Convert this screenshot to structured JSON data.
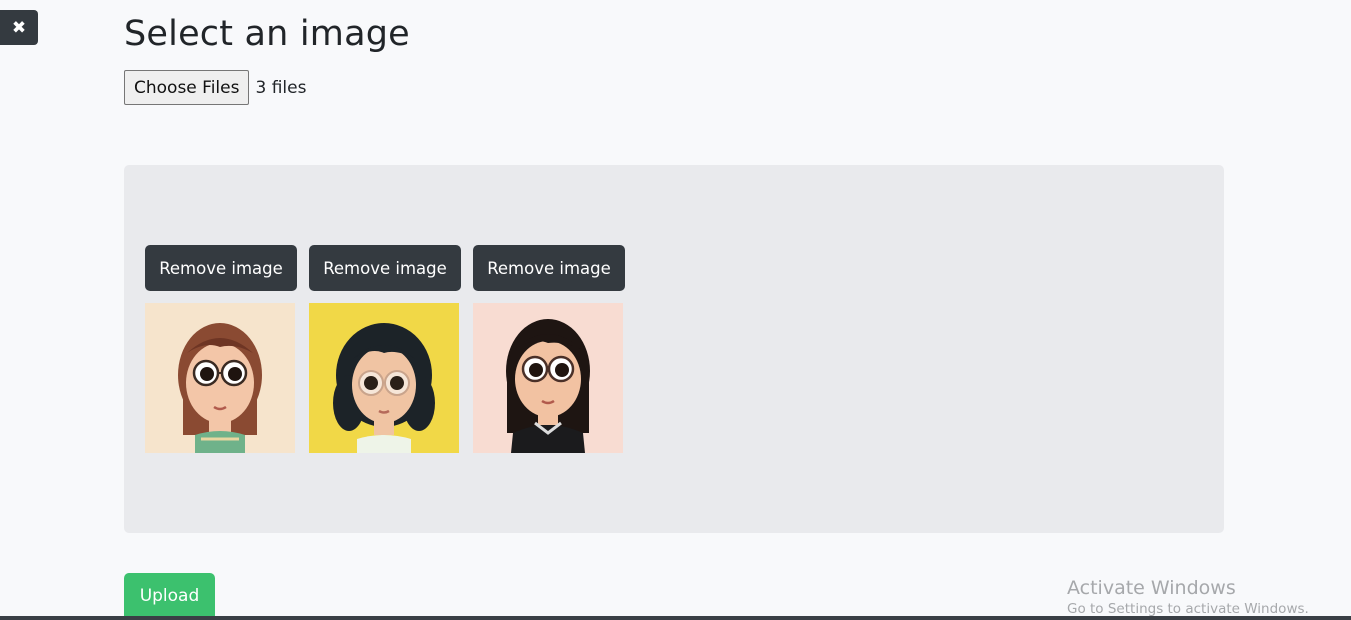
{
  "close_button": {
    "icon": "close-icon",
    "glyph": "✖"
  },
  "page": {
    "title": "Select an image"
  },
  "file_input": {
    "button_label": "Choose Files",
    "status_text": "3 files"
  },
  "preview": {
    "items": [
      {
        "remove_label": "Remove image",
        "image": "cartoon-girl-avatar-brown-hair-glasses"
      },
      {
        "remove_label": "Remove image",
        "image": "cartoon-girl-avatar-black-curly-hair-yellow-bg"
      },
      {
        "remove_label": "Remove image",
        "image": "cartoon-girl-avatar-black-hair-black-shirt"
      }
    ]
  },
  "upload": {
    "label": "Upload"
  },
  "watermark": {
    "title": "Activate Windows",
    "subtitle": "Go to Settings to activate Windows."
  },
  "colors": {
    "dark_button": "#343a40",
    "upload_button": "#3cc16e",
    "panel_bg": "#e9eaed",
    "page_bg": "#f8f9fb"
  }
}
